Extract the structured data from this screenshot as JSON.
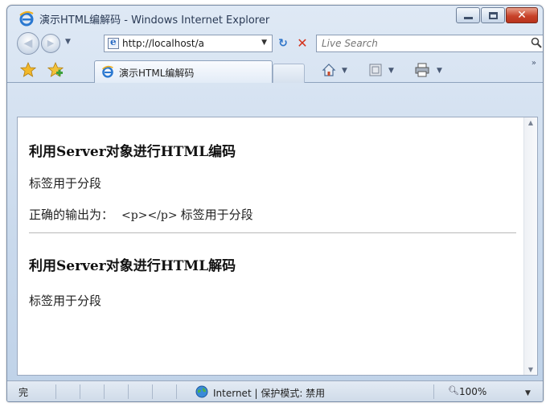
{
  "window": {
    "title": "演示HTML编解码 - Windows Internet Explorer"
  },
  "address": {
    "url": "http://localhost/a",
    "search_placeholder": "Live Search"
  },
  "tab": {
    "label": "演示HTML编解码"
  },
  "content": {
    "heading_encode": "利用Server对象进行HTML编码",
    "paragraph_1": "标签用于分段",
    "output_label": "正确的输出为：",
    "output_tag": "<p></p>",
    "output_rest": "标签用于分段",
    "heading_decode": "利用Server对象进行HTML解码",
    "paragraph_2": "标签用于分段"
  },
  "status": {
    "done": "完",
    "zone": "Internet | 保护模式: 禁用",
    "zoom": "100%"
  },
  "colors": {
    "close_button": "#c8432a",
    "stop_icon": "#d4321c",
    "refresh_icon": "#2e74c9",
    "frame": "#c9d9ec"
  }
}
